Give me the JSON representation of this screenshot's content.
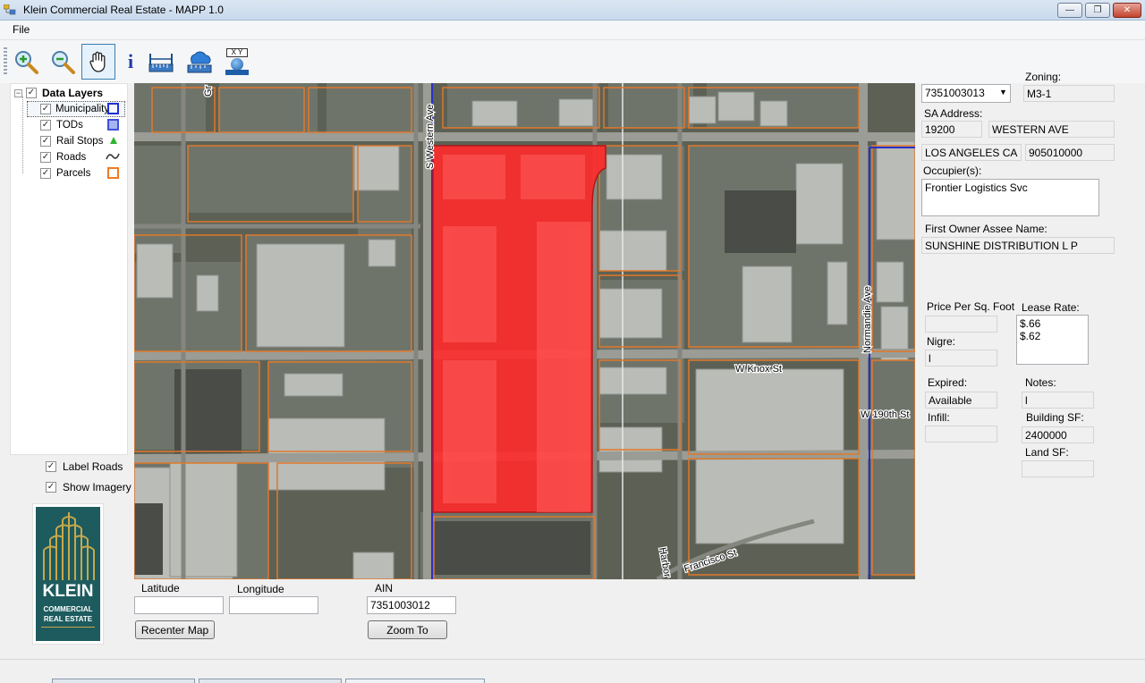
{
  "window": {
    "title": "Klein Commercial Real Estate - MAPP 1.0",
    "min_glyph": "—",
    "max_glyph": "❐",
    "close_glyph": "✕"
  },
  "menu": {
    "file": "File"
  },
  "toolbar": {
    "tools": [
      "zoom-in-icon",
      "zoom-out-icon",
      "pan-hand-icon",
      "info-icon",
      "measure-icon",
      "cloud-identify-icon",
      "xy-coordinate-icon"
    ],
    "info_glyph": "i",
    "xy_text": "X Y"
  },
  "layers": {
    "root_label": "Data Layers",
    "items": [
      {
        "label": "Municipality",
        "symbol": "square",
        "color": "#1f2fd6"
      },
      {
        "label": "TODs",
        "symbol": "square",
        "color": "#3f51d8"
      },
      {
        "label": "Rail Stops",
        "symbol": "triangle",
        "color": "#2fb52f"
      },
      {
        "label": "Roads",
        "symbol": "wave",
        "color": "#333333"
      },
      {
        "label": "Parcels",
        "symbol": "square",
        "color": "#f07a22"
      }
    ],
    "check_glyph": "✓",
    "expander_glyph": "−"
  },
  "options": {
    "label_roads": "Label Roads",
    "show_imagery": "Show Imagery"
  },
  "logo": {
    "line1": "KLEIN",
    "line2": "COMMERCIAL",
    "line3": "REAL ESTATE"
  },
  "map": {
    "street_labels": [
      "Gr",
      "S Western Ave",
      "Normandie Ave",
      "W Knox St",
      "W 190th St",
      "Francisco St",
      "Harbor"
    ],
    "highlight_color": "#ff2b2b",
    "parcel_color": "#e0782a"
  },
  "bottom": {
    "latitude_label": "Latitude",
    "longitude_label": "Longitude",
    "ain_label": "AIN",
    "latitude_value": "",
    "longitude_value": "",
    "ain_value": "7351003012",
    "recenter_button": "Recenter Map",
    "zoom_button": "Zoom To"
  },
  "details": {
    "ain_select": "7351003013",
    "zoning_label": "Zoning:",
    "zoning_value": "M3-1",
    "sa_address_label": "SA Address:",
    "street_number": "19200",
    "street_name": "WESTERN AVE",
    "city": "LOS ANGELES CA",
    "zip": "905010000",
    "occupiers_label": "Occupier(s):",
    "occupiers_value": "Frontier Logistics Svc",
    "owner_label": "First Owner Assee Name:",
    "owner_value": "SUNSHINE DISTRIBUTION L P",
    "price_label": "Price Per Sq. Foot",
    "price_value": "",
    "lease_label": "Lease Rate:",
    "lease_value": "$.66\n$.62",
    "nigre_label": "Nigre:",
    "nigre_value": "l",
    "expired_label": "Expired:",
    "expired_value": "Available",
    "notes_label": "Notes:",
    "notes_value": "l",
    "infill_label": "Infill:",
    "infill_value": "",
    "building_sf_label": "Building SF:",
    "building_sf_value": "2400000",
    "land_sf_label": "Land SF:",
    "land_sf_value": ""
  }
}
